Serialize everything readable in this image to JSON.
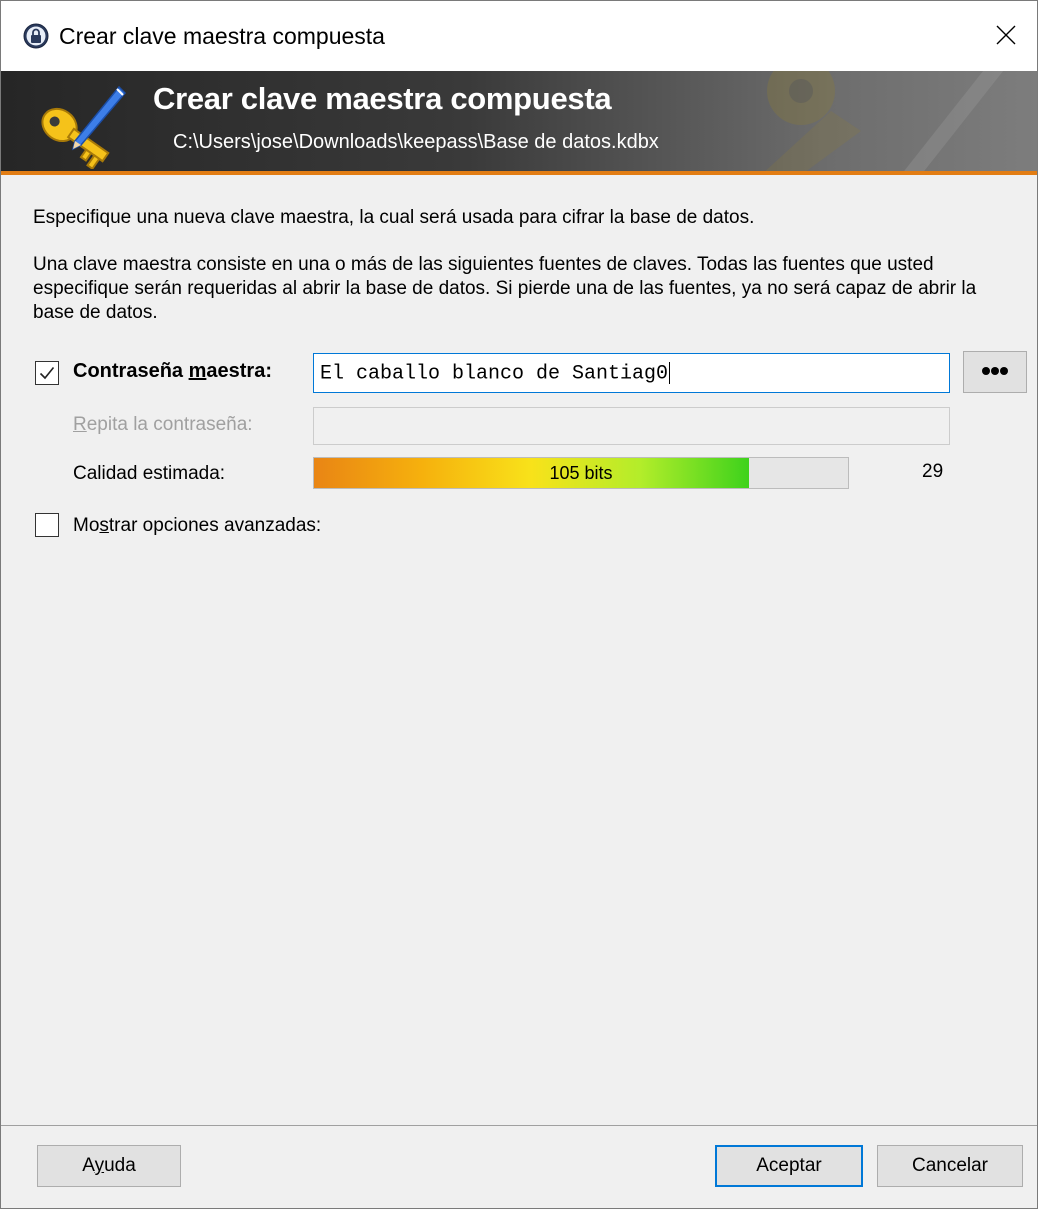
{
  "window": {
    "title": "Crear clave maestra compuesta"
  },
  "banner": {
    "title": "Crear clave maestra compuesta",
    "path": "C:\\Users\\jose\\Downloads\\keepass\\Base de datos.kdbx"
  },
  "intro": {
    "line1": "Especifique una nueva clave maestra, la cual será usada para cifrar la base de datos.",
    "line2": "Una clave maestra consiste en una o más de las siguientes fuentes de claves. Todas las fuentes que usted especifique serán requeridas al abrir la base de datos. Si pierde una de las fuentes, ya no será capaz de abrir la base de datos."
  },
  "master_password": {
    "checked": true,
    "label_pre": "Contraseña ",
    "label_accel": "m",
    "label_post": "aestra:",
    "value": "El caballo blanco de Santiag0",
    "reveal_icon": "ellipsis-icon"
  },
  "repeat_password": {
    "label_accel": "R",
    "label_post": "epita la contraseña:",
    "value": ""
  },
  "quality": {
    "label": "Calidad estimada:",
    "bits_text": "105 bits",
    "fill_fraction": 0.815,
    "char_count": "29"
  },
  "advanced": {
    "checked": false,
    "label_pre": "Mo",
    "label_accel": "s",
    "label_post": "trar opciones avanzadas:"
  },
  "footer": {
    "help_accel": "y",
    "help_pre": "A",
    "help_post": "uda",
    "ok_label": "Aceptar",
    "cancel_label": "Cancelar"
  },
  "colors": {
    "accent": "#0078d7",
    "banner_stripe": "#e27d14"
  }
}
